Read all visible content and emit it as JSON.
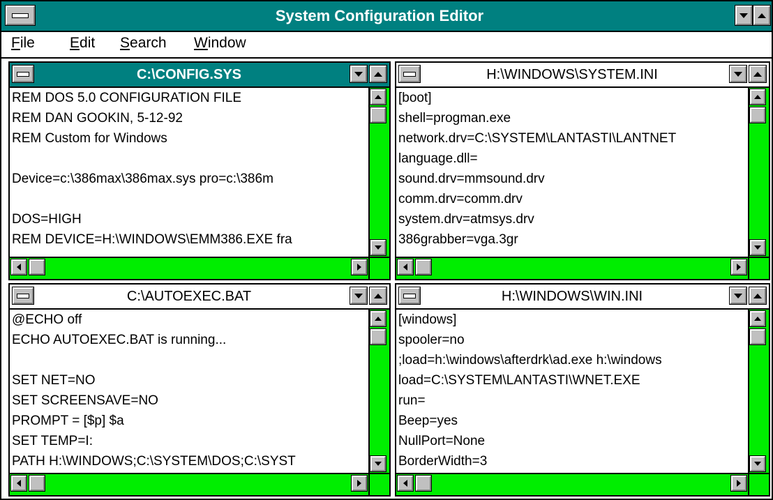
{
  "app": {
    "title": "System Configuration Editor"
  },
  "menu": [
    {
      "underline": "F",
      "rest": "ile"
    },
    {
      "underline": "E",
      "rest": "dit"
    },
    {
      "underline": "S",
      "rest": "earch"
    },
    {
      "underline": "W",
      "rest": "indow"
    }
  ],
  "colors": {
    "titlebar": "#008080",
    "scrollbar": "#00ee00"
  },
  "icons": {
    "system_menu": "system-menu-icon",
    "minimize": "minimize-icon",
    "maximize": "maximize-icon",
    "scroll_up": "scroll-up-icon",
    "scroll_down": "scroll-down-icon",
    "scroll_left": "scroll-left-icon",
    "scroll_right": "scroll-right-icon"
  },
  "windows": [
    {
      "title": "C:\\CONFIG.SYS",
      "active": true,
      "lines": [
        "REM DOS 5.0 CONFIGURATION FILE",
        "REM DAN GOOKIN, 5-12-92",
        "REM Custom for Windows",
        "",
        "Device=c:\\386max\\386max.sys pro=c:\\386m",
        "",
        "DOS=HIGH",
        "REM DEVICE=H:\\WINDOWS\\EMM386.EXE fra"
      ]
    },
    {
      "title": "H:\\WINDOWS\\SYSTEM.INI",
      "active": false,
      "lines": [
        "[boot]",
        "shell=progman.exe",
        "network.drv=C:\\SYSTEM\\LANTASTI\\LANTNET",
        "language.dll=",
        "sound.drv=mmsound.drv",
        "comm.drv=comm.drv",
        "system.drv=atmsys.drv",
        "386grabber=vga.3gr"
      ]
    },
    {
      "title": "C:\\AUTOEXEC.BAT",
      "active": false,
      "lines": [
        "@ECHO off",
        "ECHO AUTOEXEC.BAT is running...",
        "",
        "SET NET=NO",
        "SET SCREENSAVE=NO",
        "PROMPT = [$p] $a",
        "SET TEMP=I:",
        "PATH H:\\WINDOWS;C:\\SYSTEM\\DOS;C:\\SYST"
      ]
    },
    {
      "title": "H:\\WINDOWS\\WIN.INI",
      "active": false,
      "lines": [
        "[windows]",
        "spooler=no",
        ";load=h:\\windows\\afterdrk\\ad.exe h:\\windows",
        "load=C:\\SYSTEM\\LANTASTI\\WNET.EXE",
        "run=",
        "Beep=yes",
        "NullPort=None",
        "BorderWidth=3"
      ]
    }
  ]
}
